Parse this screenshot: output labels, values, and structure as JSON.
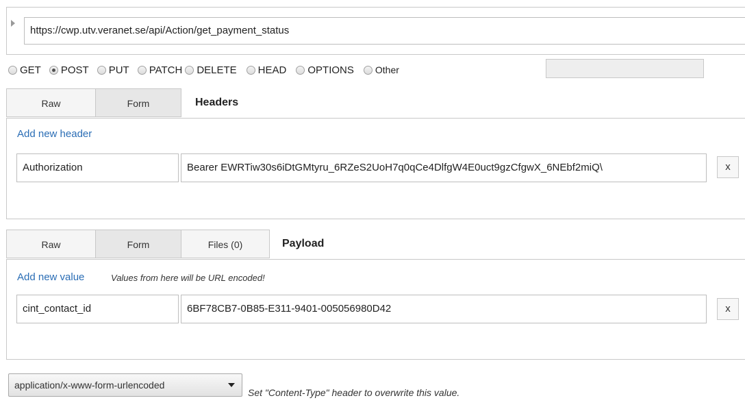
{
  "request": {
    "url": "https://cwp.utv.veranet.se/api/Action/get_payment_status",
    "methods": [
      {
        "label": "GET",
        "checked": false
      },
      {
        "label": "POST",
        "checked": true
      },
      {
        "label": "PUT",
        "checked": false
      },
      {
        "label": "PATCH",
        "checked": false
      },
      {
        "label": "DELETE",
        "checked": false
      },
      {
        "label": "HEAD",
        "checked": false
      },
      {
        "label": "OPTIONS",
        "checked": false
      },
      {
        "label": "Other",
        "checked": false
      }
    ],
    "other_value": ""
  },
  "headers": {
    "tabs": {
      "raw": "Raw",
      "form": "Form"
    },
    "active_tab": "Form",
    "title": "Headers",
    "add_link": "Add new header",
    "rows": [
      {
        "name": "Authorization",
        "value": "Bearer EWRTiw30s6iDtGMtyru_6RZeS2UoH7q0qCe4DlfgW4E0uct9gzCfgwX_6NEbf2miQ\\",
        "remove": "x"
      }
    ]
  },
  "payload": {
    "tabs": {
      "raw": "Raw",
      "form": "Form",
      "files": "Files (0)"
    },
    "active_tab": "Form",
    "title": "Payload",
    "add_link": "Add new value",
    "hint": "Values from here will be URL encoded!",
    "rows": [
      {
        "name": "cint_contact_id",
        "value": "6BF78CB7-0B85-E311-9401-005056980D42",
        "remove": "x"
      }
    ]
  },
  "content_type": {
    "selected": "application/x-www-form-urlencoded",
    "hint": "Set \"Content-Type\" header to overwrite this value."
  }
}
